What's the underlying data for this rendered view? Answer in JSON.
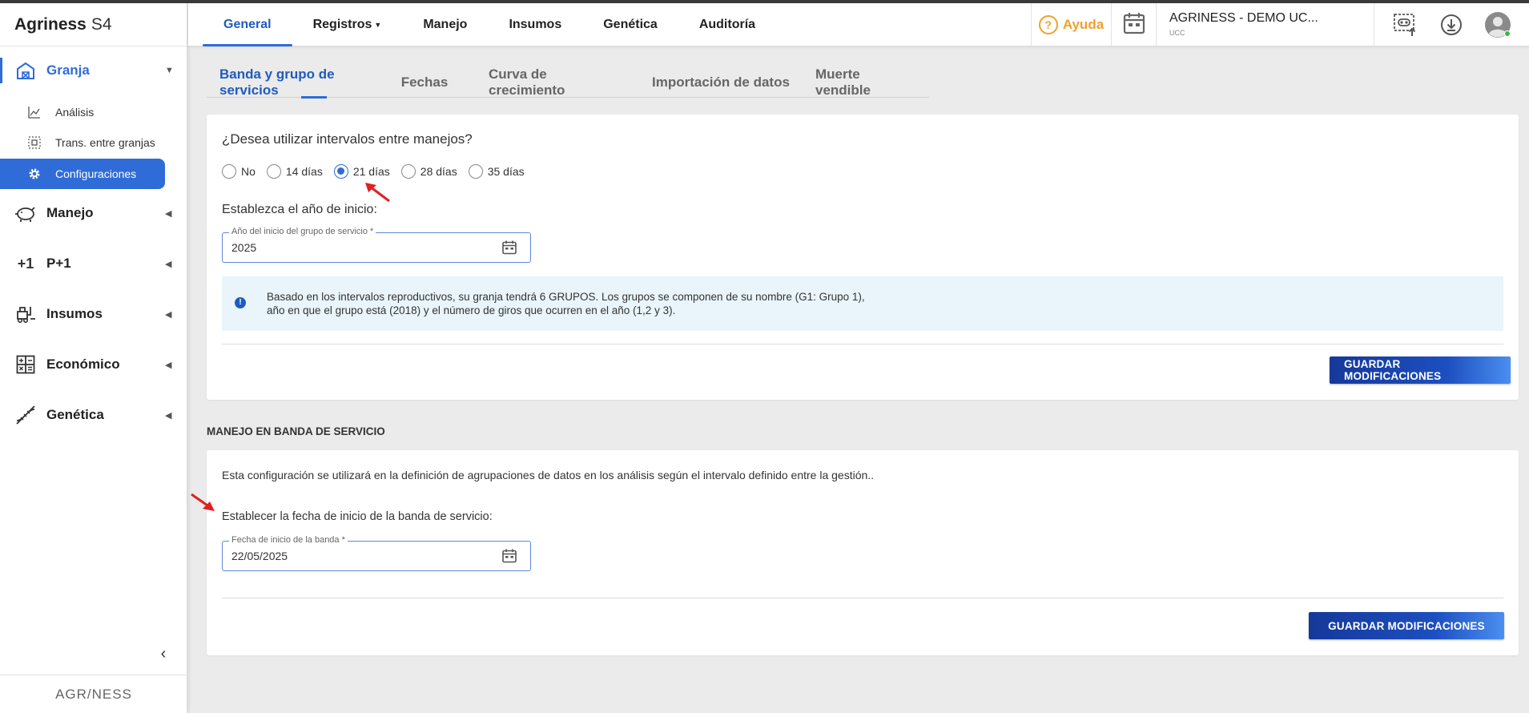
{
  "brand": {
    "name": "Agriness",
    "product": "S4",
    "footer": "AGR/NESS"
  },
  "sidebar": {
    "groups": [
      {
        "label": "Granja",
        "icon": "barn-icon",
        "active": true
      },
      {
        "label": "Manejo",
        "icon": "pig-icon"
      },
      {
        "label": "P+1",
        "icon": "plus-one-icon"
      },
      {
        "label": "Insumos",
        "icon": "forklift-icon"
      },
      {
        "label": "Económico",
        "icon": "calculator-icon"
      },
      {
        "label": "Genética",
        "icon": "dna-icon"
      }
    ],
    "granja_items": [
      {
        "label": "Análisis",
        "icon": "chart-line-icon"
      },
      {
        "label": "Trans. entre granjas",
        "icon": "transfer-icon"
      },
      {
        "label": "Configuraciones",
        "icon": "gear-icon",
        "selected": true
      }
    ]
  },
  "topnav": {
    "items": [
      "General",
      "Registros",
      "Manejo",
      "Insumos",
      "Genética",
      "Auditoría"
    ],
    "active": "General",
    "help_label": "Ayuda",
    "farm_name": "AGRINESS - DEMO UC...",
    "farm_code": "UCC"
  },
  "subtabs": {
    "items": [
      "Banda y grupo de servicios",
      "Fechas",
      "Curva de crecimiento",
      "Importación de datos",
      "Muerte vendible"
    ],
    "active": "Banda y grupo de servicios"
  },
  "card1": {
    "question": "¿Desea utilizar intervalos entre manejos?",
    "options": [
      "No",
      "14 días",
      "21 días",
      "28 días",
      "35 días"
    ],
    "selected_option": "21 días",
    "year_label": "Establezca el año de inicio:",
    "year_field_label": "Año del inicio del grupo de servicio *",
    "year_value": "2025",
    "info_text": "Basado en los intervalos reproductivos, su granja tendrá 6 GRUPOS. Los grupos se componen de su nombre (G1: Grupo 1), año en que el grupo está (2018) y el número de giros que ocurren en el año (1,2 y 3).",
    "save_label": "GUARDAR MODIFICACIONES"
  },
  "section2_title": "MANEJO EN BANDA DE SERVICIO",
  "card2": {
    "description": "Esta configuración se utilizará en la definición de agrupaciones de datos en los análisis según el intervalo definido entre la gestión..",
    "date_label": "Establecer la fecha de inicio de la banda de servicio:",
    "date_field_label": "Fecha de inicio de la banda *",
    "date_value": "22/05/2025",
    "save_label": "GUARDAR MODIFICACIONES"
  },
  "colors": {
    "accent": "#2f6cd8",
    "help": "#f0a02e",
    "annotation": "#e02020"
  }
}
